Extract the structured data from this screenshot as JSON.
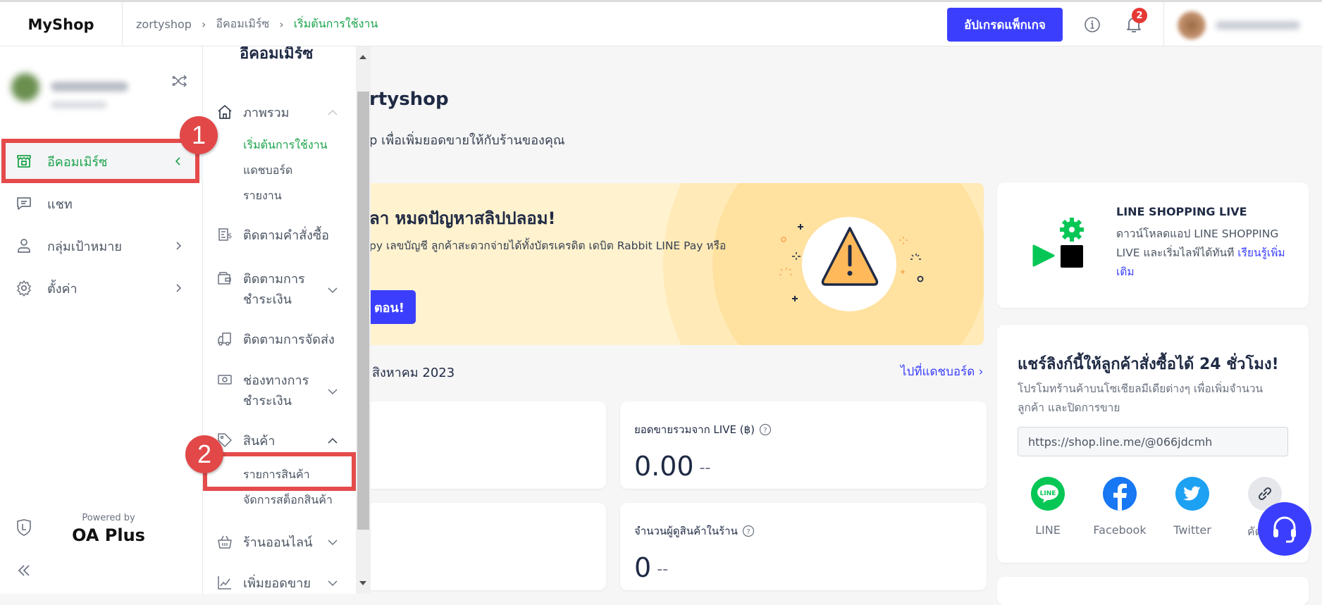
{
  "header": {
    "logo": "MyShop",
    "breadcrumb": [
      "zortyshop",
      "อีคอมเมิร์ซ",
      "เริ่มต้นการใช้งาน"
    ],
    "upgrade_label": "อัปเกรดแพ็กเกจ",
    "notification_count": "2"
  },
  "leftnav": {
    "items": [
      {
        "label": "อีคอมเมิร์ซ",
        "icon": "store-icon",
        "active": true
      },
      {
        "label": "แชท",
        "icon": "chat-icon"
      },
      {
        "label": "กลุ่มเป้าหมาย",
        "icon": "user-icon"
      },
      {
        "label": "ตั้งค่า",
        "icon": "gear-icon"
      }
    ],
    "powered_by": "Powered by",
    "brand": "OA Plus"
  },
  "annotations": [
    "1",
    "2"
  ],
  "subnav": {
    "title": "อีคอมเมิร์ซ",
    "sections": [
      {
        "label": "ภาพรวม",
        "links": [
          "เริ่มต้นการใช้งาน",
          "แดชบอร์ด",
          "รายงาน"
        ]
      },
      {
        "label": "ติดตามคำสั่งซื้อ"
      },
      {
        "label": "ติดตามการ",
        "label2": "ชำระเงิน"
      },
      {
        "label": "ติดตามการจัดส่ง"
      },
      {
        "label": "ช่องทางการ",
        "label2": "ชำระเงิน"
      },
      {
        "label": "สินค้า",
        "links": [
          "รายการสินค้า",
          "จัดการสต็อกสินค้า"
        ]
      },
      {
        "label": "ร้านออนไลน์"
      },
      {
        "label": "เพิ่มยอดขาย"
      }
    ]
  },
  "main": {
    "title": "rtyshop",
    "subtitle": "p เพื่อเพิ่มยอดขายให้กับร้านของคุณ",
    "banner": {
      "title": "ลา หมดปัญหาสลิปปลอม!",
      "text": "py เลขบัญชี ลูกค้าสะดวกจ่ายได้ทั้งบัตรเครดิต เดบิต Rabbit LINE Pay หรือ",
      "button": "ตอน!"
    },
    "month_label": "สิงหาคม 2023",
    "dashboard_link": "ไปที่แดชบอร์ด",
    "stats": [
      {
        "label": "ยอดขายรวมจาก LIVE (฿)",
        "value": "0.00",
        "trend": "--"
      },
      {
        "label": "จำนวนผู้ดูสินค้าในร้าน",
        "value": "0",
        "trend": "--"
      }
    ],
    "partial_label": ")"
  },
  "right": {
    "live": {
      "title": "LINE SHOPPING LIVE",
      "desc": "ดาวน์โหลดแอป LINE SHOPPING LIVE และเริ่มไลฟ์ได้ทันที ",
      "link": "เรียนรู้เพิ่มเติม"
    },
    "share": {
      "title": "แชร์ลิงก์นี้ให้ลูกค้าสั่งซื้อได้ 24 ชั่วโมง!",
      "desc": "โปรโมทร้านค้าบนโซเชียลมีเดียต่างๆ เพื่อเพิ่มจำนวนลูกค้า และปิดการขาย",
      "url": "https://shop.line.me/@066jdcmh",
      "socials": [
        {
          "label": "LINE",
          "color": "#06c755"
        },
        {
          "label": "Facebook",
          "color": "#1877f2"
        },
        {
          "label": "Twitter",
          "color": "#1da1f2"
        },
        {
          "label": "คัดลอก",
          "color": "#e5e7eb"
        }
      ]
    }
  },
  "colors": {
    "accent": "#3b3ffd",
    "active_green": "#1aa34a",
    "annotation_red": "#e54b4b"
  }
}
